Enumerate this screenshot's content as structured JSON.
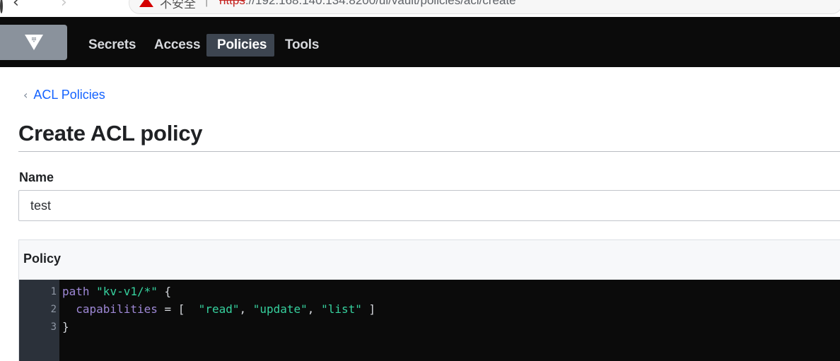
{
  "browser": {
    "insecure_label": "不安全",
    "separator": "|",
    "url_scheme": "https",
    "url_rest": "://192.168.140.134:8200/ui/vault/policies/acl/create"
  },
  "nav": {
    "items": [
      "Secrets",
      "Access",
      "Policies",
      "Tools"
    ],
    "active": "Policies"
  },
  "breadcrumb": {
    "label": "ACL Policies"
  },
  "page": {
    "title": "Create ACL policy"
  },
  "form": {
    "name_label": "Name",
    "name_value": "test",
    "policy_label": "Policy"
  },
  "editor": {
    "line_numbers": [
      "1",
      "2",
      "3"
    ],
    "line1": {
      "keyword": "path",
      "string": "\"kv-v1/*\"",
      "tail": "{"
    },
    "line2": {
      "keyword": "capabilities",
      "assign": "= [",
      "v1": "\"read\"",
      "v2": "\"update\"",
      "v3": "\"list\"",
      "close": "]"
    },
    "line3": {
      "text": "}"
    }
  },
  "colors": {
    "topnav_bg": "#0b0b0b",
    "active_nav_bg": "#3d4550",
    "link": "#1563ff",
    "editor_bg": "#0b0b0b",
    "code_keyword": "#9e88d6",
    "code_string": "#36d19e"
  },
  "icons": [
    "back-icon",
    "forward-icon",
    "reload-icon",
    "warning-icon",
    "vault-logo-icon",
    "chevron-left-icon"
  ]
}
